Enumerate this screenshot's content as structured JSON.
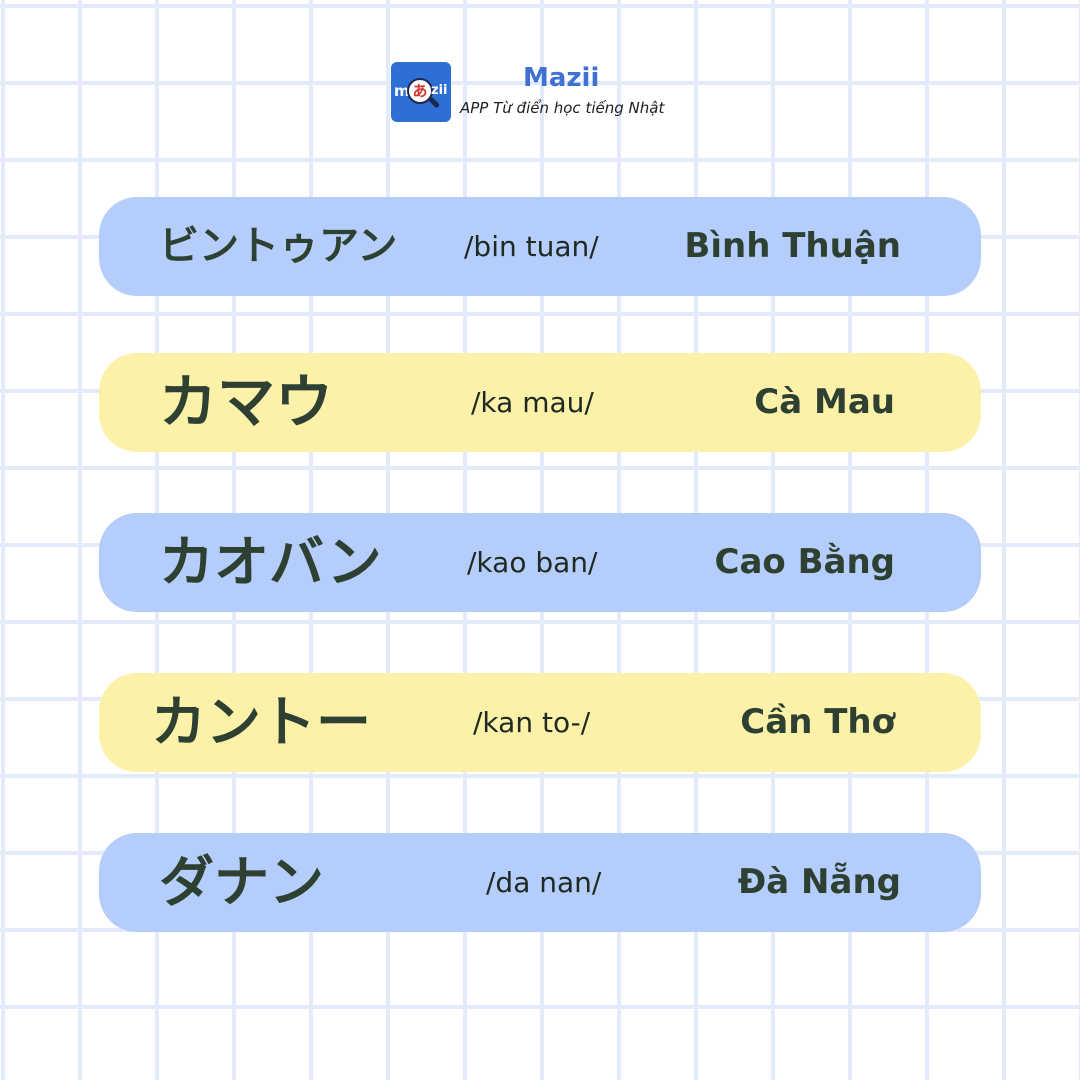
{
  "brand": {
    "logo_left": "m",
    "logo_kana": "あ",
    "logo_right": "zii",
    "name": "Mazii",
    "tagline": "APP Từ điển học tiếng Nhật"
  },
  "entries": [
    {
      "katakana": "ビントゥアン",
      "romaji": "/bin tuan/",
      "vietnamese": "Bình Thuận",
      "color": "blue"
    },
    {
      "katakana": "カマウ",
      "romaji": "/ka mau/",
      "vietnamese": "Cà Mau",
      "color": "yellow"
    },
    {
      "katakana": "カオバン",
      "romaji": "/kao ban/",
      "vietnamese": "Cao Bằng",
      "color": "blue"
    },
    {
      "katakana": "カントー",
      "romaji": "/kan to-/",
      "vietnamese": "Cần Thơ",
      "color": "yellow"
    },
    {
      "katakana": "ダナン",
      "romaji": "/da nan/",
      "vietnamese": "Đà Nẵng",
      "color": "blue"
    }
  ],
  "colors": {
    "grid_line": "#e3ebfb",
    "row_blue": "#b4cdfa",
    "row_yellow": "#fcf1a9",
    "text_dark_green": "#2d4032",
    "brand_blue": "#3f71d2"
  }
}
